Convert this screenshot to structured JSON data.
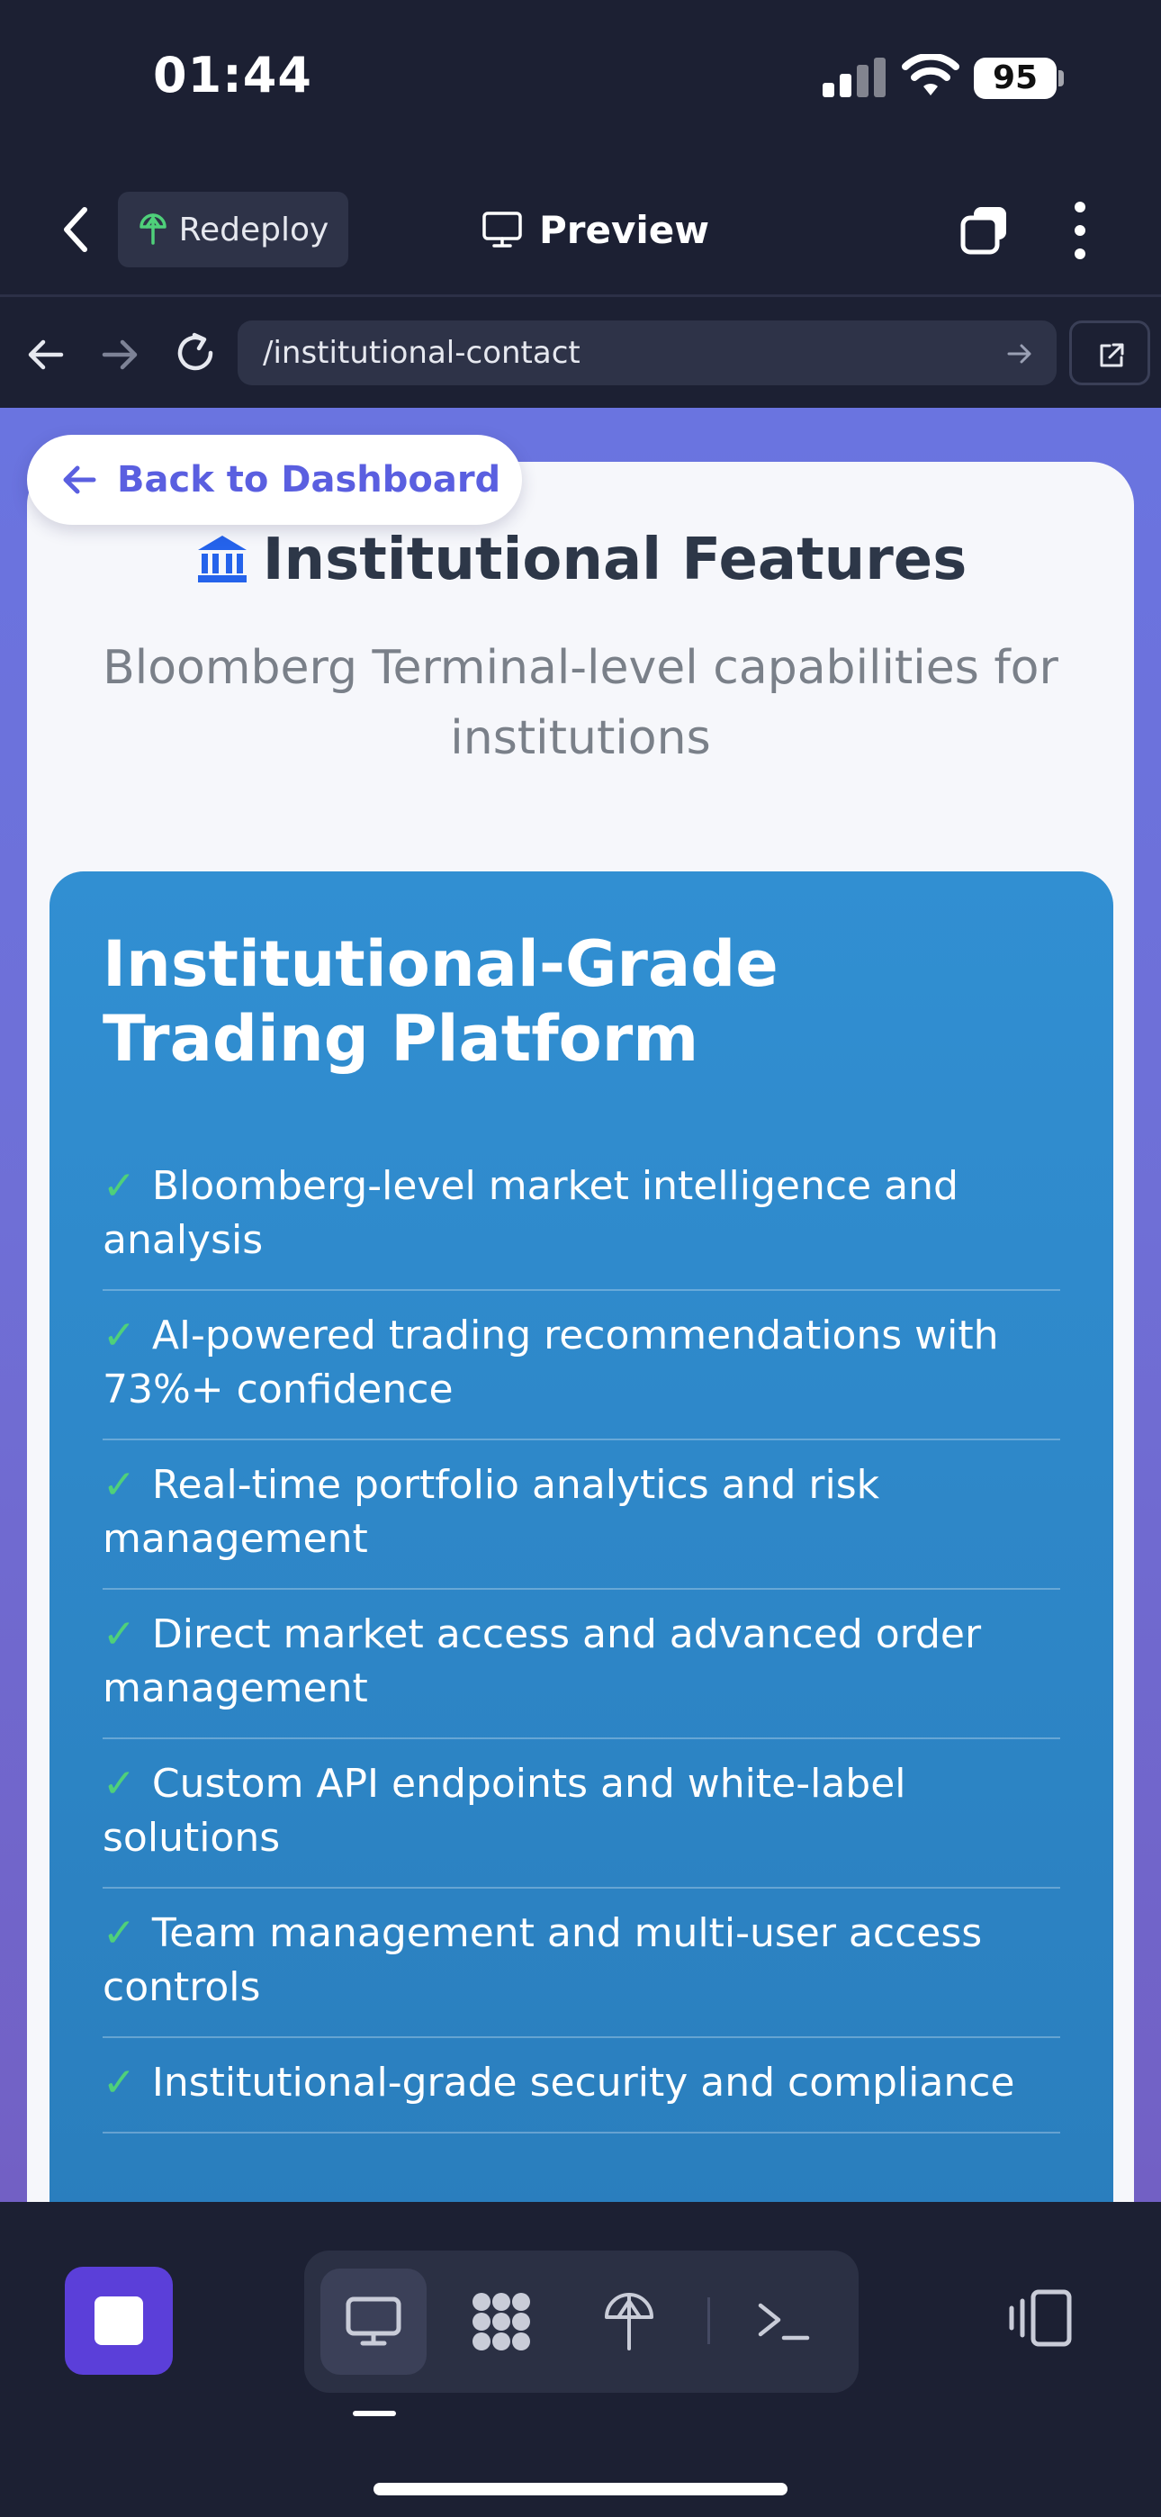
{
  "status": {
    "time": "01:44",
    "battery": "95"
  },
  "app_bar": {
    "redeploy_label": "Redeploy",
    "title": "Preview"
  },
  "browser": {
    "url": "/institutional-contact"
  },
  "page": {
    "back_label": "Back to Dashboard",
    "features_title": "Institutional Features",
    "features_subtitle": "Bloomberg Terminal-level capabilities for institutions",
    "platform_title": "Institutional-Grade Trading Platform",
    "check_mark": "✓",
    "features": [
      "Bloomberg-level market intelligence and analysis",
      "AI-powered trading recommendations with 73%+ confidence",
      "Real-time portfolio analytics and risk management",
      "Direct market access and advanced order management",
      "Custom API endpoints and white-label solutions",
      "Team management and multi-user access controls",
      "Institutional-grade security and compliance"
    ]
  },
  "colors": {
    "accent": "#5b3fd9",
    "link": "#5a5fe0",
    "panel_blue": "#318fd2",
    "check_green": "#4fd07a",
    "background_gradient_start": "#6a74e0",
    "background_gradient_end": "#7260c4"
  },
  "icons": {
    "status": [
      "signal-icon",
      "wifi-icon",
      "battery-icon"
    ],
    "app_bar": [
      "chevron-left-icon",
      "deploy-icon",
      "monitor-icon",
      "tabs-icon",
      "more-vertical-icon"
    ],
    "browser": [
      "arrow-left-icon",
      "arrow-right-icon",
      "reload-icon",
      "go-arrow-icon",
      "external-link-icon"
    ],
    "toolbar": [
      "stop-icon",
      "monitor-icon",
      "apps-grid-icon",
      "deploy-icon",
      "terminal-icon",
      "panel-toggle-icon"
    ]
  }
}
